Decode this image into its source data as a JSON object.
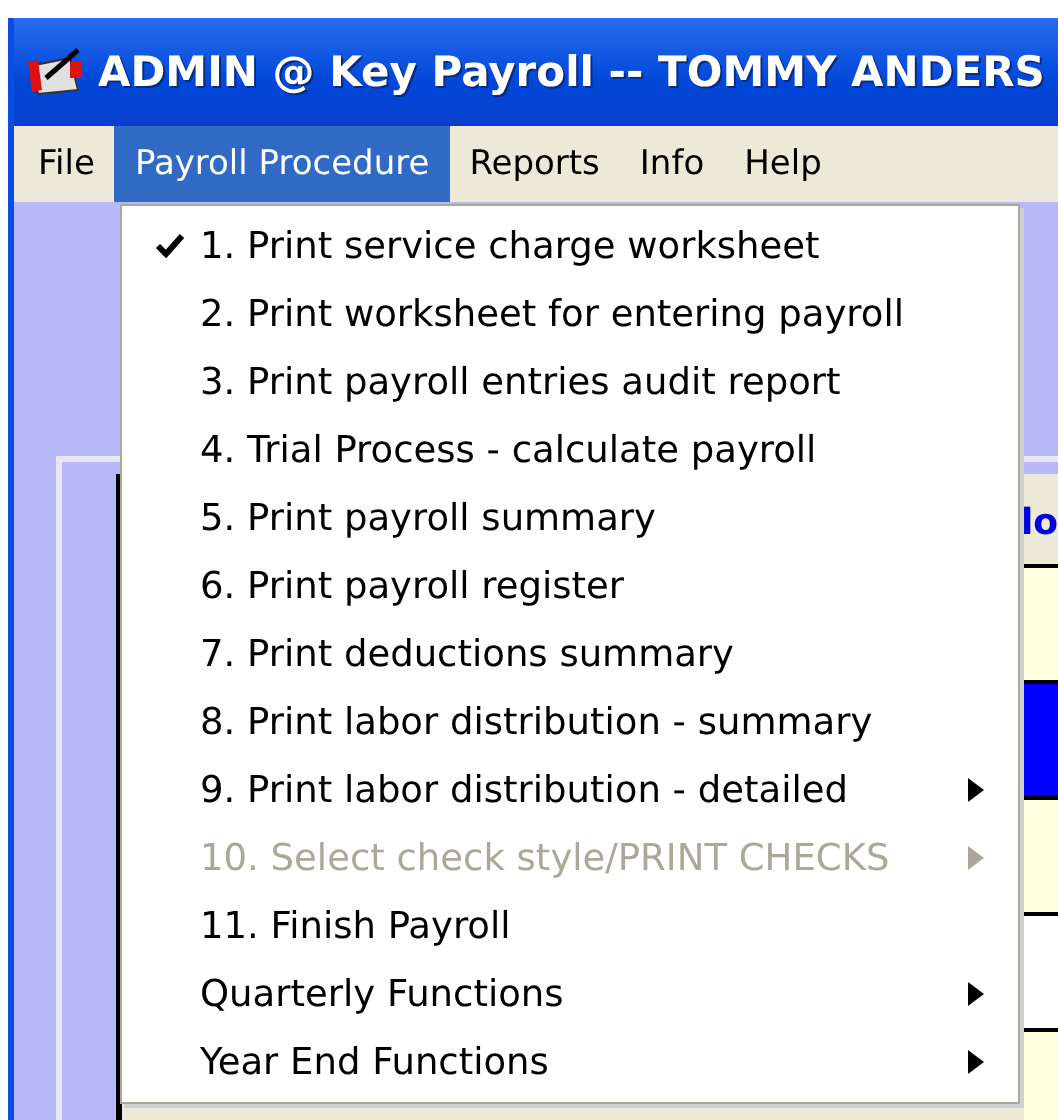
{
  "window": {
    "title": "ADMIN @ Key Payroll -- TOMMY ANDERS"
  },
  "menubar": [
    {
      "label": "File",
      "selected": false
    },
    {
      "label": "Payroll Procedure",
      "selected": true
    },
    {
      "label": "Reports",
      "selected": false
    },
    {
      "label": "Info",
      "selected": false
    },
    {
      "label": "Help",
      "selected": false
    }
  ],
  "dropdown": [
    {
      "label": "1. Print service charge worksheet",
      "checked": true,
      "disabled": false,
      "submenu": false
    },
    {
      "label": "2. Print worksheet for entering payroll",
      "checked": false,
      "disabled": false,
      "submenu": false
    },
    {
      "label": "3. Print payroll entries audit report",
      "checked": false,
      "disabled": false,
      "submenu": false
    },
    {
      "label": "4. Trial Process - calculate payroll",
      "checked": false,
      "disabled": false,
      "submenu": false
    },
    {
      "label": "5. Print payroll summary",
      "checked": false,
      "disabled": false,
      "submenu": false
    },
    {
      "label": "6. Print payroll register",
      "checked": false,
      "disabled": false,
      "submenu": false
    },
    {
      "label": "7. Print deductions summary",
      "checked": false,
      "disabled": false,
      "submenu": false
    },
    {
      "label": "8. Print labor distribution - summary",
      "checked": false,
      "disabled": false,
      "submenu": false
    },
    {
      "label": "9. Print labor distribution - detailed",
      "checked": false,
      "disabled": false,
      "submenu": true
    },
    {
      "label": "10. Select check style/PRINT CHECKS",
      "checked": false,
      "disabled": true,
      "submenu": true
    },
    {
      "label": "11. Finish Payroll",
      "checked": false,
      "disabled": false,
      "submenu": false
    },
    {
      "label": "Quarterly Functions",
      "checked": false,
      "disabled": false,
      "submenu": true
    },
    {
      "label": "Year End Functions",
      "checked": false,
      "disabled": false,
      "submenu": true
    }
  ],
  "grid": {
    "column_1": "lo",
    "rows": [
      {
        "selected": false
      },
      {
        "selected": true
      },
      {
        "selected": false
      },
      {
        "selected": false
      },
      {
        "selected": false
      }
    ]
  }
}
